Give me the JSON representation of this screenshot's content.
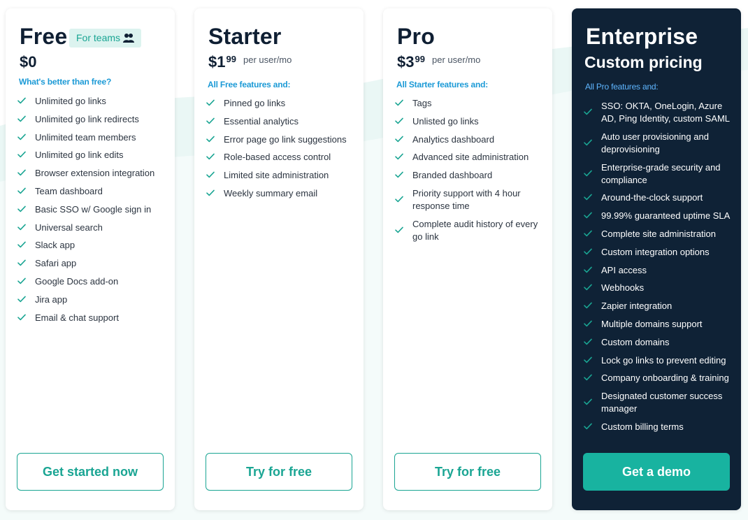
{
  "colors": {
    "accent": "#1aa593",
    "accent_fill": "#18b3a0",
    "link_blue": "#1c9ad6",
    "enterprise_bg": "#0f2236",
    "text_dark": "#0f1f33"
  },
  "plans": {
    "free": {
      "name": "Free",
      "badge": "For teams",
      "badge_icon": "people-icon",
      "price": "$0",
      "subhead": "What's better than free?",
      "features": [
        "Unlimited go links",
        "Unlimited go link redirects",
        "Unlimited team members",
        "Unlimited go link edits",
        "Browser extension integration",
        "Team dashboard",
        "Basic SSO w/ Google sign in",
        "Universal search",
        "Slack app",
        "Safari app",
        "Google Docs add-on",
        "Jira app",
        "Email & chat support"
      ],
      "cta": "Get started now"
    },
    "starter": {
      "name": "Starter",
      "price_dollars": "$1",
      "price_cents": "99",
      "per_user": "per user/mo",
      "subhead": "All Free features and:",
      "features": [
        "Pinned go links",
        "Essential analytics",
        "Error page go link suggestions",
        "Role-based access control",
        "Limited site administration",
        "Weekly summary email"
      ],
      "cta": "Try for free"
    },
    "pro": {
      "name": "Pro",
      "price_dollars": "$3",
      "price_cents": "99",
      "per_user": "per user/mo",
      "subhead": "All Starter features and:",
      "features": [
        "Tags",
        "Unlisted go links",
        "Analytics dashboard",
        "Advanced site administration",
        "Branded dashboard",
        "Priority support with 4 hour response time",
        "Complete audit history of every go link"
      ],
      "cta": "Try for free"
    },
    "enterprise": {
      "name": "Enterprise",
      "price_text": "Custom pricing",
      "subhead": "All Pro features and:",
      "features": [
        "SSO: OKTA, OneLogin, Azure AD, Ping Identity, custom SAML",
        "Auto user provisioning and deprovisioning",
        "Enterprise-grade security and compliance",
        "Around-the-clock support",
        "99.99% guaranteed uptime SLA",
        "Complete site administration",
        "Custom integration options",
        "API access",
        "Webhooks",
        "Zapier integration",
        "Multiple domains support",
        "Custom domains",
        "Lock go links to prevent editing",
        "Company onboarding & training",
        "Designated customer success manager",
        "Custom billing terms"
      ],
      "cta": "Get a demo"
    }
  }
}
